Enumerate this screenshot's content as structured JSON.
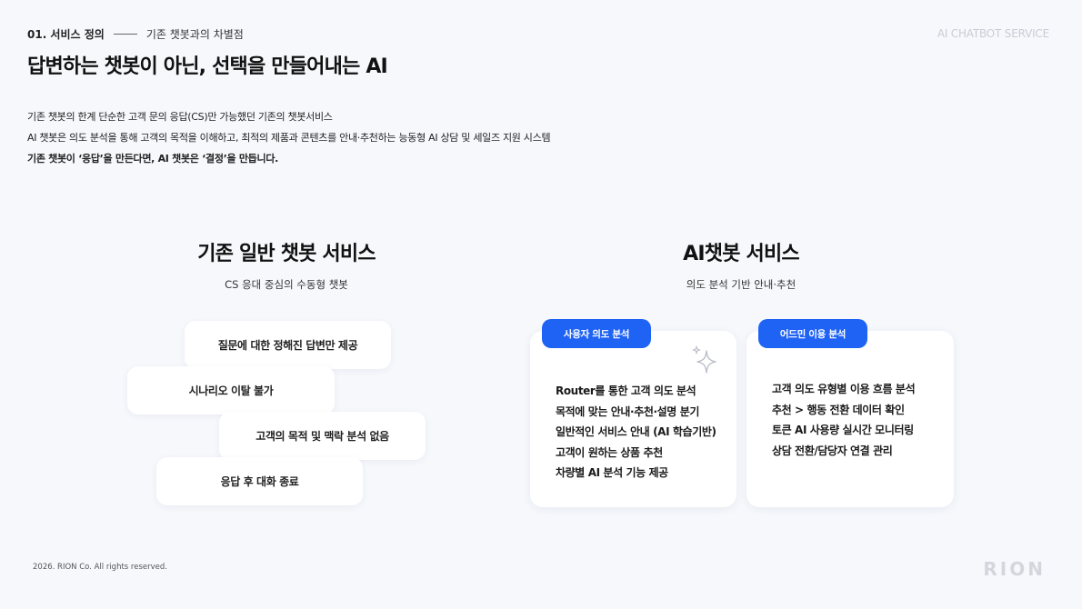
{
  "header": {
    "section_number": "01. 서비스 정의",
    "section_subtitle": "기존 챗봇과의 차별점",
    "brand_label": "AI CHATBOT SERVICE",
    "headline": "답변하는 챗봇이 아닌, 선택을 만들어내는 AI"
  },
  "description": {
    "line1": "기존 챗봇의 한계 단순한 고객 문의 응답(CS)만 가능했던 기존의 챗봇서비스",
    "line2": "AI 챗봇은 의도 분석을 통해 고객의 목적을 이해하고, 최적의 제품과 콘텐츠를 안내·추천하는 능동형 AI 상담 및 세일즈 지원 시스템",
    "line3": "기존 챗봇이 ‘응답’을 만든다면, AI 챗봇은 ‘결정’을 만듭니다."
  },
  "left_column": {
    "title": "기존 일반 챗봇 서비스",
    "subtitle": "CS 응대 중심의 수동형 챗봇",
    "items": [
      "질문에 대한 정해진 답변만 제공",
      "시나리오 이탈 불가",
      "고객의 목적 및 맥락 분석 없음",
      "응답 후 대화 종료"
    ]
  },
  "right_column": {
    "title": "AI챗봇 서비스",
    "subtitle": "의도 분석 기반 안내·추천",
    "cards": [
      {
        "tag": "사용자 의도 분석",
        "items": [
          "Router를 통한 고객 의도 분석",
          "목적에 맞는 안내·추천·설명 분기",
          "일반적인 서비스 안내 (AI 학습기반)",
          "고객이 원하는 상품 추천",
          "차량별 AI 분석 기능 제공"
        ]
      },
      {
        "tag": "어드민 이용 분석",
        "items": [
          "고객 의도 유형별 이용 흐름 분석",
          "추천 > 행동 전환 데이터 확인",
          "토큰 AI 사용량 실시간 모니터링",
          "상담 전환/담당자 연결 관리"
        ]
      }
    ]
  },
  "footer": {
    "copyright": "2026. RION Co. All rights reserved.",
    "logo": "RION"
  },
  "colors": {
    "background": "#f6f8fc",
    "accent_blue": "#1f63f5",
    "card": "#ffffff"
  }
}
